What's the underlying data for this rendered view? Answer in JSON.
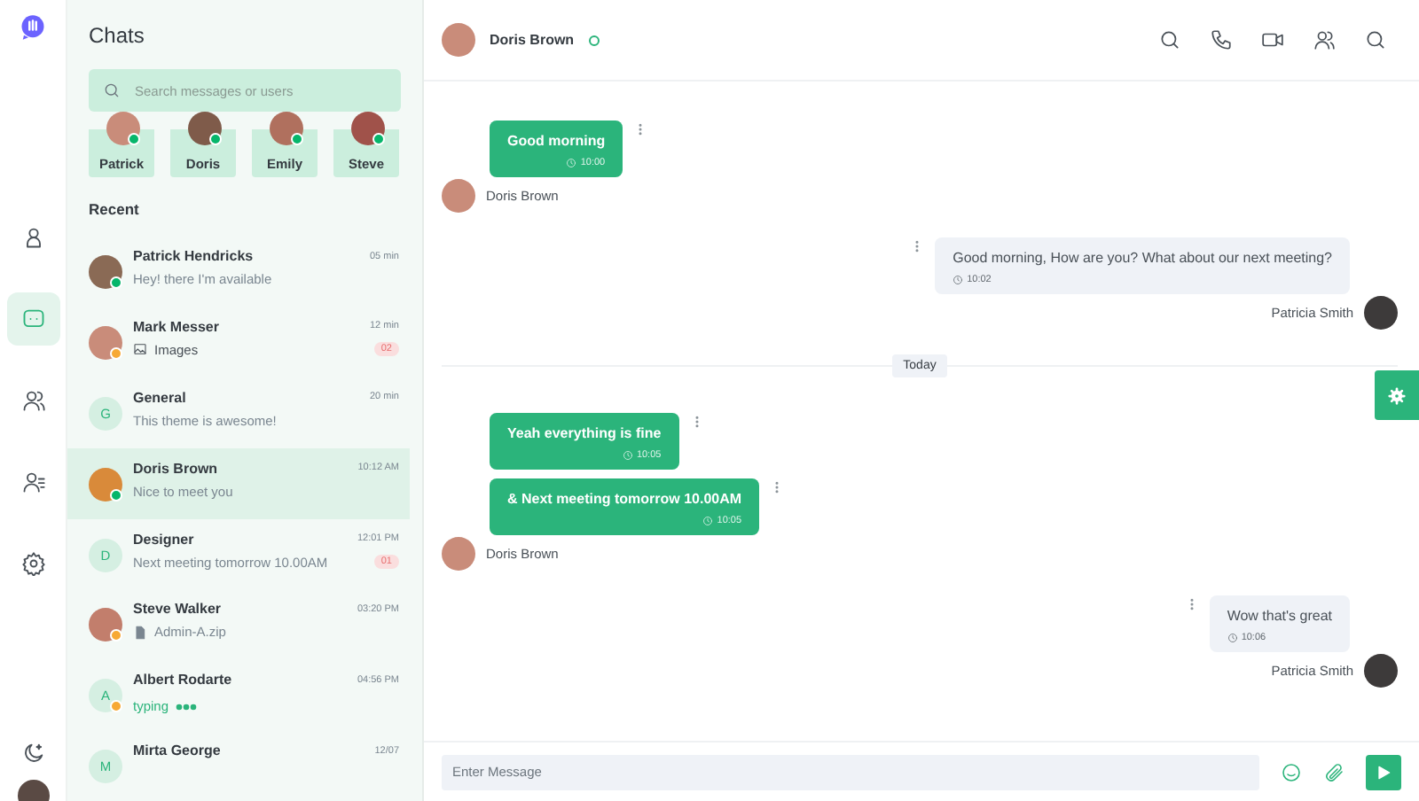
{
  "rail": {
    "items": [
      {
        "kind": "profile",
        "selected": false
      },
      {
        "kind": "chats",
        "selected": true
      },
      {
        "kind": "contacts",
        "selected": false
      },
      {
        "kind": "contact-list",
        "selected": false
      },
      {
        "kind": "settings",
        "selected": false
      }
    ]
  },
  "chats": {
    "title": "Chats",
    "search": {
      "placeholder": "Search messages or users"
    },
    "favourites": [
      {
        "name": "Patrick",
        "color": "#06b66b"
      },
      {
        "name": "Doris",
        "color": "#06b66b"
      },
      {
        "name": "Emily",
        "color": "#06b66b"
      },
      {
        "name": "Steve",
        "color": "#06b66b"
      }
    ],
    "section": "Recent",
    "conversations": [
      {
        "name": "Patrick Hendricks",
        "time": "05 min",
        "preview": {
          "kind": "text",
          "text": "Hey! there I'm available"
        },
        "avatar": {
          "kind": "photo"
        },
        "color": "#06b66b",
        "selected": false
      },
      {
        "name": "Mark Messer",
        "time": "12 min",
        "preview": {
          "kind": "image",
          "text": "Images"
        },
        "badge": "02",
        "avatar": {
          "kind": "photo"
        },
        "color": "#f7a935",
        "selected": false
      },
      {
        "name": "General",
        "time": "20 min",
        "preview": {
          "kind": "text",
          "text": "This theme is awesome!"
        },
        "avatar": {
          "kind": "initial",
          "initial": "G"
        },
        "selected": false
      },
      {
        "name": "Doris Brown",
        "time": "10:12 AM",
        "preview": {
          "kind": "text",
          "text": "Nice to meet you"
        },
        "avatar": {
          "kind": "photo"
        },
        "color": "#06b66b",
        "selected": true
      },
      {
        "name": "Designer",
        "time": "12:01 PM",
        "preview": {
          "kind": "text",
          "text": "Next meeting tomorrow 10.00AM"
        },
        "badge": "01",
        "avatar": {
          "kind": "initial",
          "initial": "D"
        },
        "selected": false
      },
      {
        "name": "Steve Walker",
        "time": "03:20 PM",
        "preview": {
          "kind": "file",
          "text": "Admin-A.zip"
        },
        "avatar": {
          "kind": "photo"
        },
        "color": "#f7a935",
        "selected": false
      },
      {
        "name": "Albert Rodarte",
        "time": "04:56 PM",
        "preview": {
          "kind": "typing",
          "text": "typing"
        },
        "avatar": {
          "kind": "initial",
          "initial": "A"
        },
        "color": "#f7a935",
        "selected": false
      },
      {
        "name": "Mirta George",
        "time": "12/07",
        "avatar": {
          "kind": "initial",
          "initial": "M"
        },
        "selected": false
      }
    ]
  },
  "header": {
    "name": "Doris Brown",
    "online": true
  },
  "messages": [
    {
      "kind": "received",
      "sender": "Doris Brown",
      "bubbles": [
        {
          "text": "Good morning",
          "time": "10:00"
        }
      ]
    },
    {
      "kind": "sent",
      "sender": "Patricia Smith",
      "bubbles": [
        {
          "text": "Good morning, How are you? What about our next meeting?",
          "time": "10:02"
        }
      ]
    },
    {
      "kind": "divider",
      "text": "Today"
    },
    {
      "kind": "received",
      "sender": "Doris Brown",
      "bubbles": [
        {
          "text": "Yeah everything is fine",
          "time": "10:05"
        },
        {
          "text": "& Next meeting tomorrow 10.00AM",
          "time": "10:05"
        }
      ]
    },
    {
      "kind": "sent",
      "sender": "Patricia Smith",
      "bubbles": [
        {
          "text": "Wow that's great",
          "time": "10:06"
        }
      ]
    }
  ],
  "composer": {
    "placeholder": "Enter Message"
  }
}
